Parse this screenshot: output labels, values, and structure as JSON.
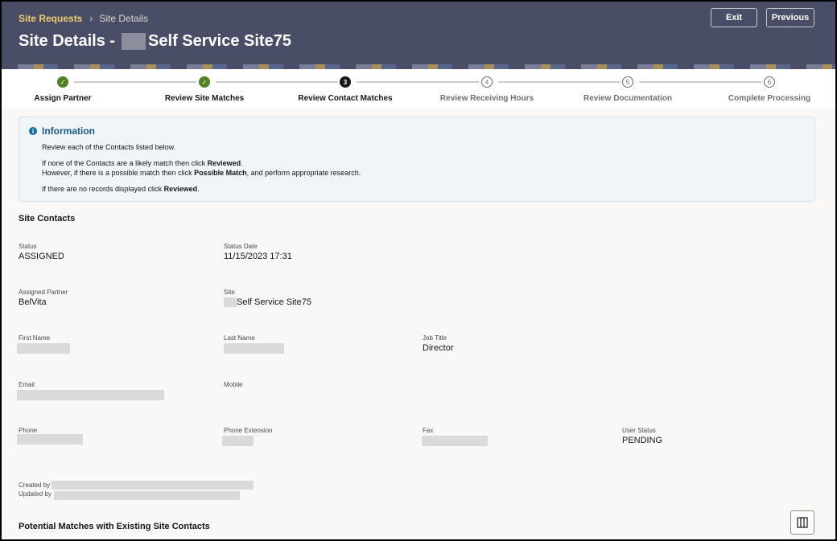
{
  "breadcrumb": {
    "parent": "Site Requests",
    "separator": "›",
    "current": "Site Details"
  },
  "page": {
    "title_prefix": "Site Details -",
    "title_suffix": "Self Service Site75"
  },
  "header_buttons": {
    "exit": "Exit",
    "previous": "Previous"
  },
  "train": {
    "steps": [
      {
        "label": "Assign Partner",
        "state": "done",
        "marker": "✓"
      },
      {
        "label": "Review Site Matches",
        "state": "done",
        "marker": "✓"
      },
      {
        "label": "Review Contact Matches",
        "state": "current",
        "marker": "3"
      },
      {
        "label": "Review Receiving Hours",
        "state": "todo",
        "marker": "4"
      },
      {
        "label": "Review Documentation",
        "state": "todo",
        "marker": "5"
      },
      {
        "label": "Complete Processing",
        "state": "todo",
        "marker": "6"
      }
    ]
  },
  "info": {
    "icon": "i",
    "title": "Information",
    "line1": "Review each of the Contacts listed below.",
    "line2_pre": "If none of the Contacts are a likely match then click ",
    "line2_bold": "Reviewed",
    "line2_post": ".",
    "line3_pre": "However, if there is a possible match then click ",
    "line3_bold": "Possible Match",
    "line3_post": ", and perform appropriate research.",
    "line4_pre": "If there are no records displayed click ",
    "line4_bold": "Reviewed",
    "line4_post": "."
  },
  "site_contacts": {
    "section_title": "Site Contacts",
    "status_label": "Status",
    "status_value": "ASSIGNED",
    "status_date_label": "Status Date",
    "status_date_value": "11/15/2023 17:31",
    "assigned_partner_label": "Assigned Partner",
    "assigned_partner_value": "BelVita",
    "site_label": "Site",
    "site_value": "Self Service Site75",
    "first_name_label": "First Name",
    "last_name_label": "Last Name",
    "job_title_label": "Job Title",
    "job_title_value": "Director",
    "email_label": "Email",
    "mobile_label": "Mobile",
    "phone_label": "Phone",
    "phone_ext_label": "Phone Extension",
    "fax_label": "Fax",
    "user_status_label": "User Status",
    "user_status_value": "PENDING",
    "created_by_label": "Created by",
    "updated_by_label": "Updated by"
  },
  "matches": {
    "section_title": "Potential Matches with Existing Site Contacts",
    "columns_button_icon": "columns-icon"
  },
  "colors": {
    "header_bg": "#4a4d66",
    "breadcrumb_link": "#f0cc71",
    "step_done": "#508223",
    "info_bg": "#eff5f8",
    "info_title": "#1c5a8a"
  }
}
